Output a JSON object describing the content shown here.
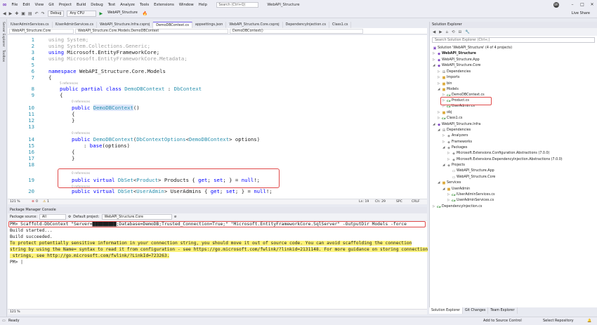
{
  "title_bar": {
    "menu": [
      "File",
      "Edit",
      "View",
      "Git",
      "Project",
      "Build",
      "Debug",
      "Test",
      "Analyze",
      "Tools",
      "Extensions",
      "Window",
      "Help"
    ],
    "search_placeholder": "Search (Ctrl+Q)",
    "window_title": "WebAPI_Structure",
    "avatar": "BR"
  },
  "toolbar": {
    "config": "Debug",
    "platform": "Any CPU",
    "run_target": "WebAPI_Structure",
    "live_share": "Live Share"
  },
  "left_strip": [
    "Server Explorer",
    "Toolbox"
  ],
  "tabs": [
    "IUserAdminServices.cs",
    "IUserAdminServices.cs",
    "WebAPI_Structure.Infra.csproj",
    "DemoDBContext.cs",
    "appsettings.json",
    "WebAPI_Structure.Core.csproj",
    "DependencyInjection.cs",
    "Class1.cs"
  ],
  "active_tab": "DemoDBContext.cs",
  "navbar": {
    "project": "WebAPI_Structure.Core",
    "class": "WebAPI_Structure.Core.Models.DemoDBContext",
    "member": "DemoDBContext()"
  },
  "code": {
    "line_numbers": [
      "1",
      "2",
      "3",
      "4",
      "5",
      "6",
      "7",
      "8",
      "9",
      "10",
      "11",
      "12",
      "13",
      "14",
      "15",
      "16",
      "17",
      "18",
      "19",
      "20"
    ],
    "refs": {
      "r5": "5 references",
      "r0a": "0 references",
      "r0b": "0 references",
      "r0c": "0 references",
      "r0d": "0 references"
    },
    "l1_kw": "using",
    "l1_rest": " System;",
    "l2_kw": "using",
    "l2_rest": " System.Collections.Generic;",
    "l3_kw": "using",
    "l3_rest": " Microsoft.EntityFrameworkCore;",
    "l4_kw": "using",
    "l4_rest": " Microsoft.EntityFrameworkCore.Metadata;",
    "l6_kw": "namespace",
    "l6_rest": " WebAPI_Structure.Core.Models",
    "brace_open": "{",
    "brace_close": "}",
    "l8_kw": "public partial class",
    "l8_type": " DemoDBContext",
    "l8_sep": " : ",
    "l8_base": "DbContext",
    "l10_kw": "public",
    "l10_type": "DemoDBContext",
    "l10_rest": "()",
    "l14_kw": "public",
    "l14_type": " DemoDBContext",
    "l14_p1": "(",
    "l14_opt": "DbContextOptions",
    "l14_lt": "<",
    "l14_arg": "DemoDBContext",
    "l14_rest": "> options)",
    "l15_sep": ": ",
    "l15_kw": "base",
    "l15_rest": "(options)",
    "l19_kw": "public virtual",
    "l19_t1": " DbSet",
    "l19_lt": "<",
    "l19_t2": "Product",
    "l19_rest": "> Products { ",
    "l19_get": "get",
    "l19_semi": "; ",
    "l19_set": "set",
    "l19_end": "; } = ",
    "l19_null": "null",
    "l19_bang": "!;",
    "l20_kw": "public virtual",
    "l20_t1": " DbSet",
    "l20_lt": "<",
    "l20_t2": "UserAdmin",
    "l20_rest": "> UserAdmins { ",
    "l20_get": "get",
    "l20_semi": "; ",
    "l20_set": "set",
    "l20_end": "; } = ",
    "l20_null": "null",
    "l20_bang": "!;"
  },
  "editor_status": {
    "zoom": "121 %",
    "errors": "0",
    "warnings": "1",
    "line": "Ln: 19",
    "col": "Ch: 29",
    "spc": "SPC",
    "crlf": "CRLF"
  },
  "pmc": {
    "title": "Package Manager Console",
    "source_label": "Package source:",
    "source_value": "All",
    "project_label": "Default project:",
    "project_value": "WebAPI_Structure.Core",
    "output": [
      "PM> Scaffold-DbContext \"Server=█████████;Database=DemoDB;Trusted_Connection=True;\" \"Microsoft.EntityFrameworkCore.SqlServer\" -OutputDir Models -force",
      "Build started...",
      "Build succeeded.",
      "To protect potentially sensitive information in your connection string, you should move it out of source code. You can avoid scaffolding the connection",
      "string by using the Name= syntax to read it from configuration - see https://go.microsoft.com/fwlink/?linkid=2131148. For more guidance on storing connection",
      " strings, see http://go.microsoft.com/fwlink/?LinkId=723263.",
      "PM> |"
    ],
    "zoom": "121 %"
  },
  "solution_explorer": {
    "title": "Solution Explorer",
    "search_placeholder": "Search Solution Explorer (Ctrl+;)",
    "items": [
      "Solution 'WebAPI_Structure' (4 of 4 projects)",
      "WebAPI_Structure",
      "WebAPI_Structure.App",
      "WebAPI_Structure.Core",
      "Dependencies",
      "Imports",
      "bin",
      "Models",
      "DemoDBContext.cs",
      "Product.cs",
      "UserAdmin.cs",
      "obj",
      "Class1.cs",
      "WebAPI_Structure.Infra",
      "Dependencies",
      "Analyzers",
      "Frameworks",
      "Packages",
      "Microsoft.Extensions.Configuration.Abstractions (7.0.0)",
      "Microsoft.Extensions.DependencyInjection.Abstractions (7.0.0)",
      "Projects",
      "WebAPI_Structure.App",
      "WebAPI_Structure.Core",
      "Services",
      "UserAdmin",
      "IUserAdminServices.cs",
      "UserAdminServices.cs",
      "DependencyInjection.cs"
    ],
    "bottom_tabs": [
      "Solution Explorer",
      "Git Changes",
      "Team Explorer"
    ]
  },
  "status_bar": {
    "ready": "Ready",
    "source_control": "Add to Source Control",
    "repo": "Select Repository"
  }
}
